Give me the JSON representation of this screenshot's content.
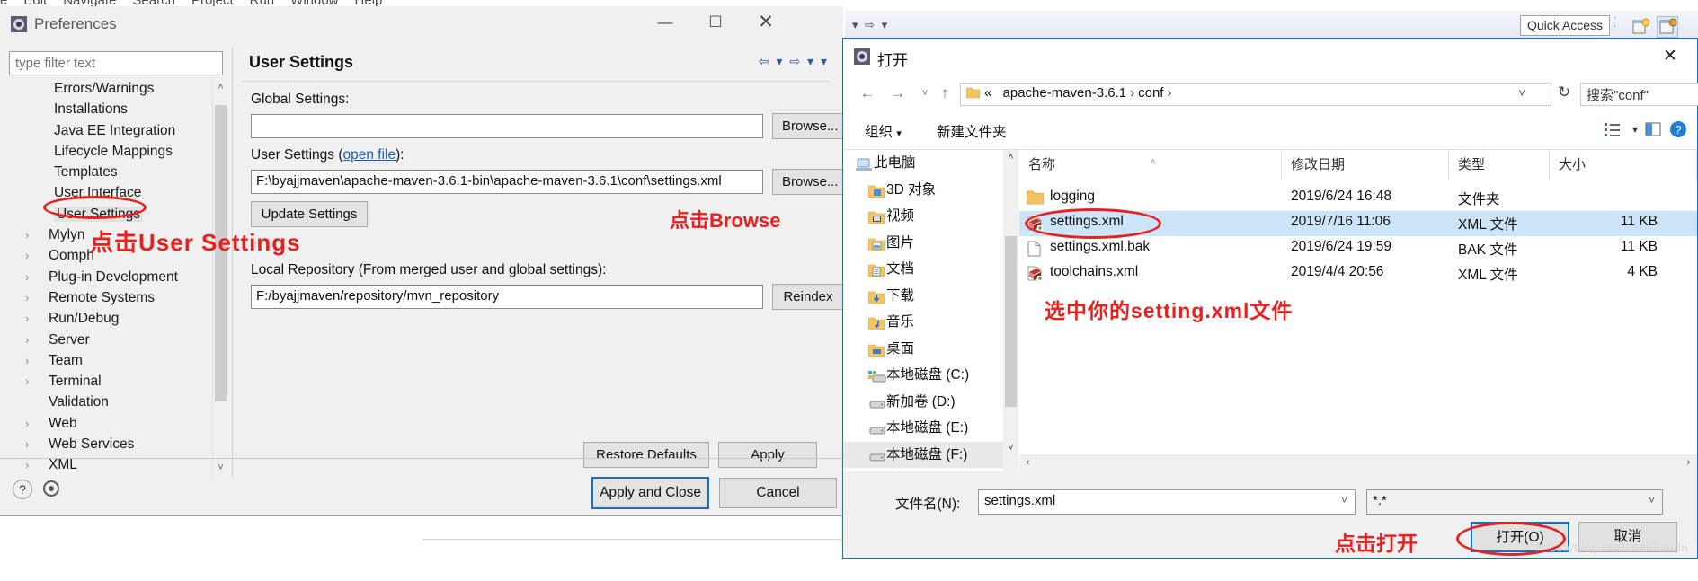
{
  "eclipse": {
    "menu_items": [
      "e",
      "Edit",
      "Navigate",
      "Search",
      "Project",
      "Run",
      "Window",
      "Help"
    ],
    "quick_access": "Quick Access"
  },
  "preferences": {
    "title": "Preferences",
    "window_buttons": {
      "minimize": "—",
      "maximize": "☐",
      "close": "✕"
    },
    "filter_placeholder": "type filter text",
    "tree": [
      {
        "label": "Errors/Warnings",
        "twisty": "",
        "child": true,
        "selected": false
      },
      {
        "label": "Installations",
        "twisty": "",
        "child": true,
        "selected": false
      },
      {
        "label": "Java EE Integration",
        "twisty": "",
        "child": true,
        "selected": false
      },
      {
        "label": "Lifecycle Mappings",
        "twisty": "",
        "child": true,
        "selected": false
      },
      {
        "label": "Templates",
        "twisty": "",
        "child": true,
        "selected": false
      },
      {
        "label": "User Interface",
        "twisty": "",
        "child": true,
        "selected": false
      },
      {
        "label": "User Settings",
        "twisty": "",
        "child": true,
        "selected": true
      },
      {
        "label": "Mylyn",
        "twisty": "›",
        "child": false,
        "selected": false
      },
      {
        "label": "Oomph",
        "twisty": "›",
        "child": false,
        "selected": false
      },
      {
        "label": "Plug-in Development",
        "twisty": "›",
        "child": false,
        "selected": false
      },
      {
        "label": "Remote Systems",
        "twisty": "›",
        "child": false,
        "selected": false
      },
      {
        "label": "Run/Debug",
        "twisty": "›",
        "child": false,
        "selected": false
      },
      {
        "label": "Server",
        "twisty": "›",
        "child": false,
        "selected": false
      },
      {
        "label": "Team",
        "twisty": "›",
        "child": false,
        "selected": false
      },
      {
        "label": "Terminal",
        "twisty": "›",
        "child": false,
        "selected": false
      },
      {
        "label": "Validation",
        "twisty": "",
        "child": false,
        "selected": false
      },
      {
        "label": "Web",
        "twisty": "›",
        "child": false,
        "selected": false
      },
      {
        "label": "Web Services",
        "twisty": "›",
        "child": false,
        "selected": false
      },
      {
        "label": "XML",
        "twisty": "›",
        "child": false,
        "selected": false
      }
    ],
    "page": {
      "title": "User Settings",
      "global_settings_label": "Global Settings:",
      "global_settings_value": "",
      "user_settings_label_pre": "User Settings (",
      "user_settings_link": "open file",
      "user_settings_label_post": "):",
      "user_settings_value": "F:\\byajjmaven\\apache-maven-3.6.1-bin\\apache-maven-3.6.1\\conf\\settings.xml",
      "update_settings_label": "Update Settings",
      "browse_label": "Browse...",
      "local_repo_label": "Local Repository (From merged user and global settings):",
      "local_repo_value": "F:/byajjmaven/repository/mvn_repository",
      "reindex_label": "Reindex",
      "restore_defaults_label": "Restore Defaults",
      "apply_label": "Apply"
    },
    "footer": {
      "apply_and_close_label": "Apply and Close",
      "cancel_label": "Cancel"
    }
  },
  "open_dialog": {
    "title": "打开",
    "close_label": "✕",
    "breadcrumb": {
      "prefix": "«",
      "parts": [
        "apache-maven-3.6.1",
        "conf"
      ],
      "separator": "›"
    },
    "search_placeholder": "搜索\"conf\"",
    "refresh_label": "↻",
    "toolbar": {
      "organize": "组织",
      "new_folder": "新建文件夹"
    },
    "nav_pane": [
      {
        "label": "此电脑",
        "icon": "computer-icon",
        "indent": false,
        "selected": false
      },
      {
        "label": "3D 对象",
        "icon": "folder-3d-icon",
        "indent": true,
        "selected": false
      },
      {
        "label": "视频",
        "icon": "folder-video-icon",
        "indent": true,
        "selected": false
      },
      {
        "label": "图片",
        "icon": "folder-pictures-icon",
        "indent": true,
        "selected": false
      },
      {
        "label": "文档",
        "icon": "folder-documents-icon",
        "indent": true,
        "selected": false
      },
      {
        "label": "下载",
        "icon": "folder-downloads-icon",
        "indent": true,
        "selected": false
      },
      {
        "label": "音乐",
        "icon": "folder-music-icon",
        "indent": true,
        "selected": false
      },
      {
        "label": "桌面",
        "icon": "folder-desktop-icon",
        "indent": true,
        "selected": false
      },
      {
        "label": "本地磁盘 (C:)",
        "icon": "drive-windows-icon",
        "indent": true,
        "selected": false
      },
      {
        "label": "新加卷 (D:)",
        "icon": "drive-icon",
        "indent": true,
        "selected": false
      },
      {
        "label": "本地磁盘 (E:)",
        "icon": "drive-icon",
        "indent": true,
        "selected": false
      },
      {
        "label": "本地磁盘 (F:)",
        "icon": "drive-icon",
        "indent": true,
        "selected": true
      }
    ],
    "columns": [
      "名称",
      "修改日期",
      "类型",
      "大小"
    ],
    "files": [
      {
        "name": "logging",
        "icon": "folder-icon",
        "date": "2019/6/24 16:48",
        "type": "文件夹",
        "size": "",
        "selected": false
      },
      {
        "name": "settings.xml",
        "icon": "xml-file-icon",
        "date": "2019/7/16 11:06",
        "type": "XML 文件",
        "size": "11 KB",
        "selected": true
      },
      {
        "name": "settings.xml.bak",
        "icon": "bak-file-icon",
        "date": "2019/6/24 19:59",
        "type": "BAK 文件",
        "size": "11 KB",
        "selected": false
      },
      {
        "name": "toolchains.xml",
        "icon": "xml-file-icon",
        "date": "2019/4/4 20:56",
        "type": "XML 文件",
        "size": "4 KB",
        "selected": false
      }
    ],
    "filename_label": "文件名(N):",
    "filename_value": "settings.xml",
    "filetype_value": "*.*",
    "open_button": "打开(O)",
    "cancel_button": "取消",
    "watermark": "https://blog.csdn.net/headn"
  },
  "annotations": {
    "click_user_settings": "点击User Settings",
    "click_browse": "点击Browse",
    "select_your_settings_file": "选中你的setting.xml文件",
    "click_open": "点击打开"
  },
  "colors": {
    "annotation_red": "#e8211f",
    "selection_blue": "#cce4f7",
    "accent_blue": "#0078d7",
    "link_blue": "#1a5fb4"
  }
}
